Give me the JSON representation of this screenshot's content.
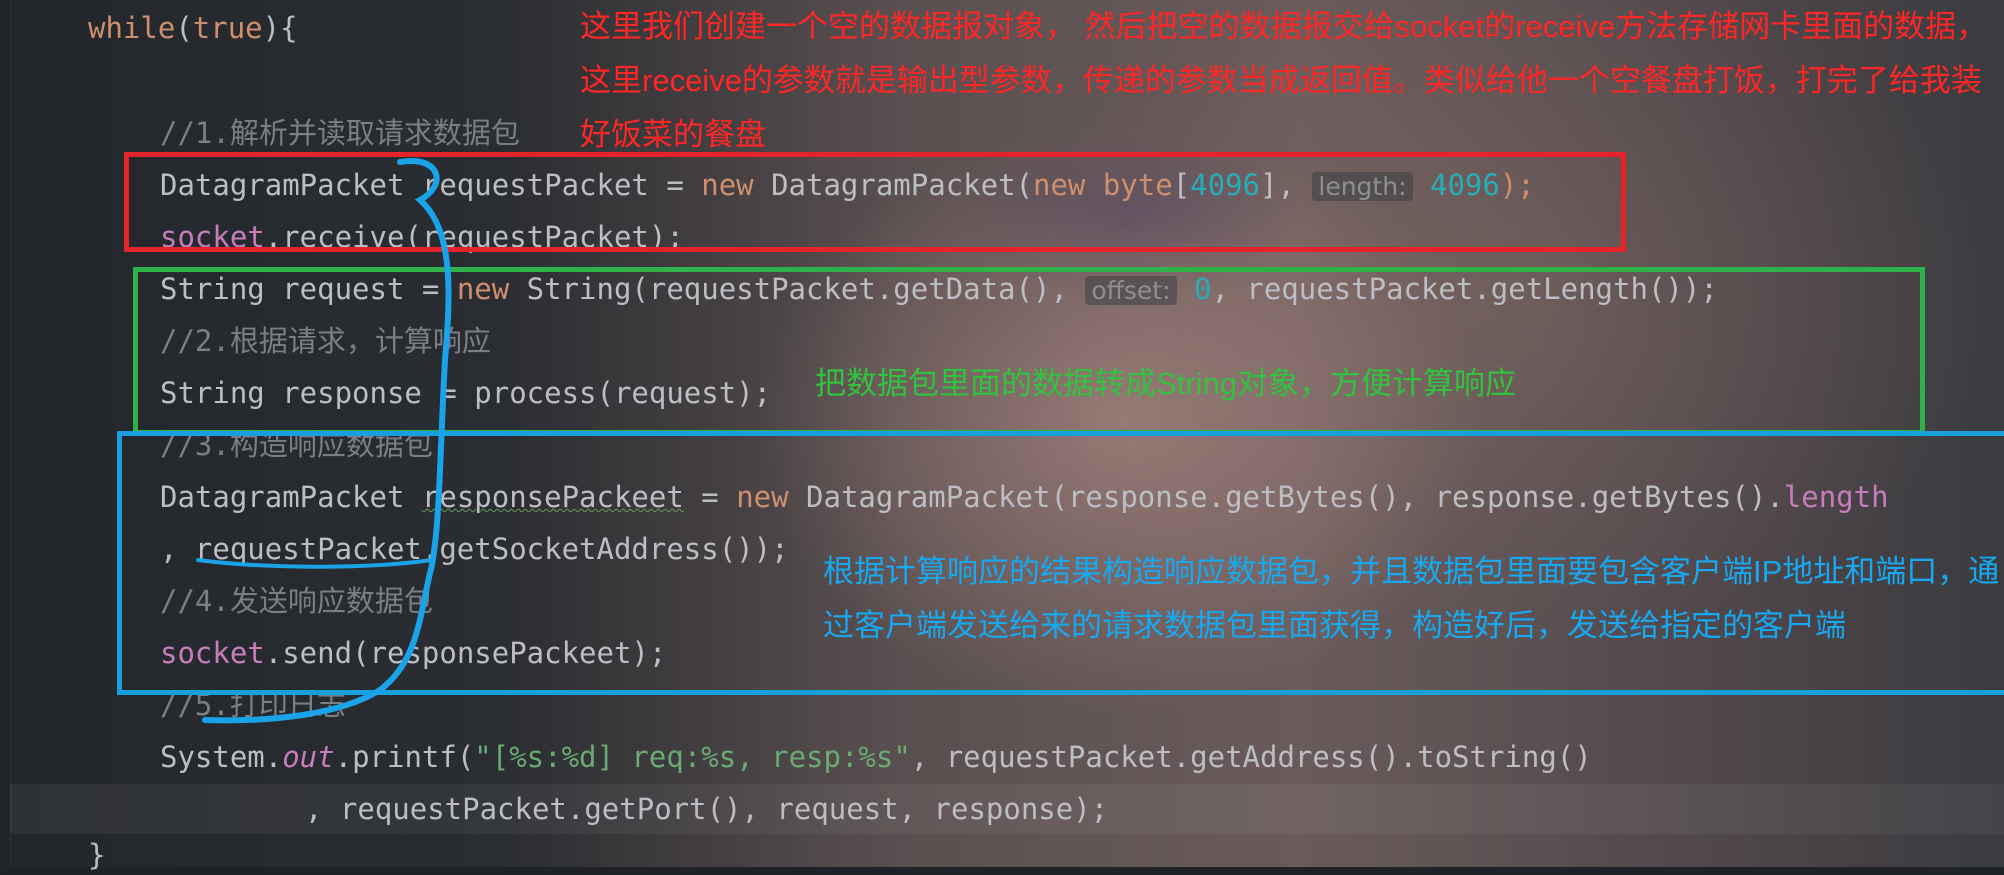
{
  "editor": {
    "lines": [
      {
        "id": "l1",
        "parts": [
          "while",
          "(",
          "true",
          "){"
        ]
      },
      {
        "id": "l2",
        "parts": [
          "//1.解析并读取请求数据包"
        ]
      },
      {
        "id": "l3",
        "parts": [
          "DatagramPacket requestPacket = ",
          "new ",
          "DatagramPacket(",
          "new ",
          "byte",
          "[",
          "4096",
          "], ",
          "length:",
          " ",
          "4096",
          ");"
        ]
      },
      {
        "id": "l4",
        "parts": [
          "socket",
          ".receive(requestPacket);"
        ]
      },
      {
        "id": "l5",
        "parts": [
          "String request = ",
          "new ",
          "String(requestPacket.getData(), ",
          "offset:",
          " ",
          "0",
          ", requestPacket.getLength());"
        ]
      },
      {
        "id": "l6",
        "parts": [
          "//2.根据请求，计算响应"
        ]
      },
      {
        "id": "l7",
        "parts": [
          "String response = process(request);"
        ]
      },
      {
        "id": "l8",
        "parts": [
          "//3.构造响应数据包"
        ]
      },
      {
        "id": "l9",
        "parts": [
          "DatagramPacket ",
          "responsePackeet",
          " = ",
          "new ",
          "DatagramPacket(response.getBytes(), response.getBytes().",
          "length"
        ]
      },
      {
        "id": "l10",
        "parts": [
          ", requestPacket.getSocketAddress());"
        ]
      },
      {
        "id": "l11",
        "parts": [
          "//4.发送响应数据包"
        ]
      },
      {
        "id": "l12",
        "parts": [
          "socket",
          ".send(responsePackeet);"
        ]
      },
      {
        "id": "l13",
        "parts": [
          "//5.打印日志"
        ]
      },
      {
        "id": "l14",
        "parts": [
          "System.",
          "out",
          ".printf(",
          "\"[%s:%d] req:%s, resp:%s\"",
          ", requestPacket.getAddress().toString()"
        ]
      },
      {
        "id": "l15",
        "parts": [
          ", requestPacket.getPort(), request, response);"
        ]
      },
      {
        "id": "l16",
        "parts": [
          "}"
        ]
      }
    ]
  },
  "annotations": {
    "red_note": "这里我们创建一个空的数据报对象， 然后把空的数据报交给socket的receive方法存储网卡里面的数据，这里receive的参数就是输出型参数，传递的参数当成返回值。类似给他一个空餐盘打饭，打完了给我装好饭菜的餐盘",
    "green_note": "把数据包里面的数据转成String对象，方便计算响应",
    "blue_note": "根据计算响应的结果构造响应数据包，并且数据包里面要包含客户端IP地址和端口，通过客户端发送给来的请求数据包里面获得，构造好后，发送给指定的客户端"
  },
  "colors": {
    "keyword": "#cf8e6d",
    "comment": "#7a7e85",
    "field": "#c77dbb",
    "number": "#2aacb8",
    "string": "#6aab73",
    "annotation_red": "#e3242b",
    "annotation_green": "#2fb24a",
    "annotation_blue": "#17a0dc"
  }
}
